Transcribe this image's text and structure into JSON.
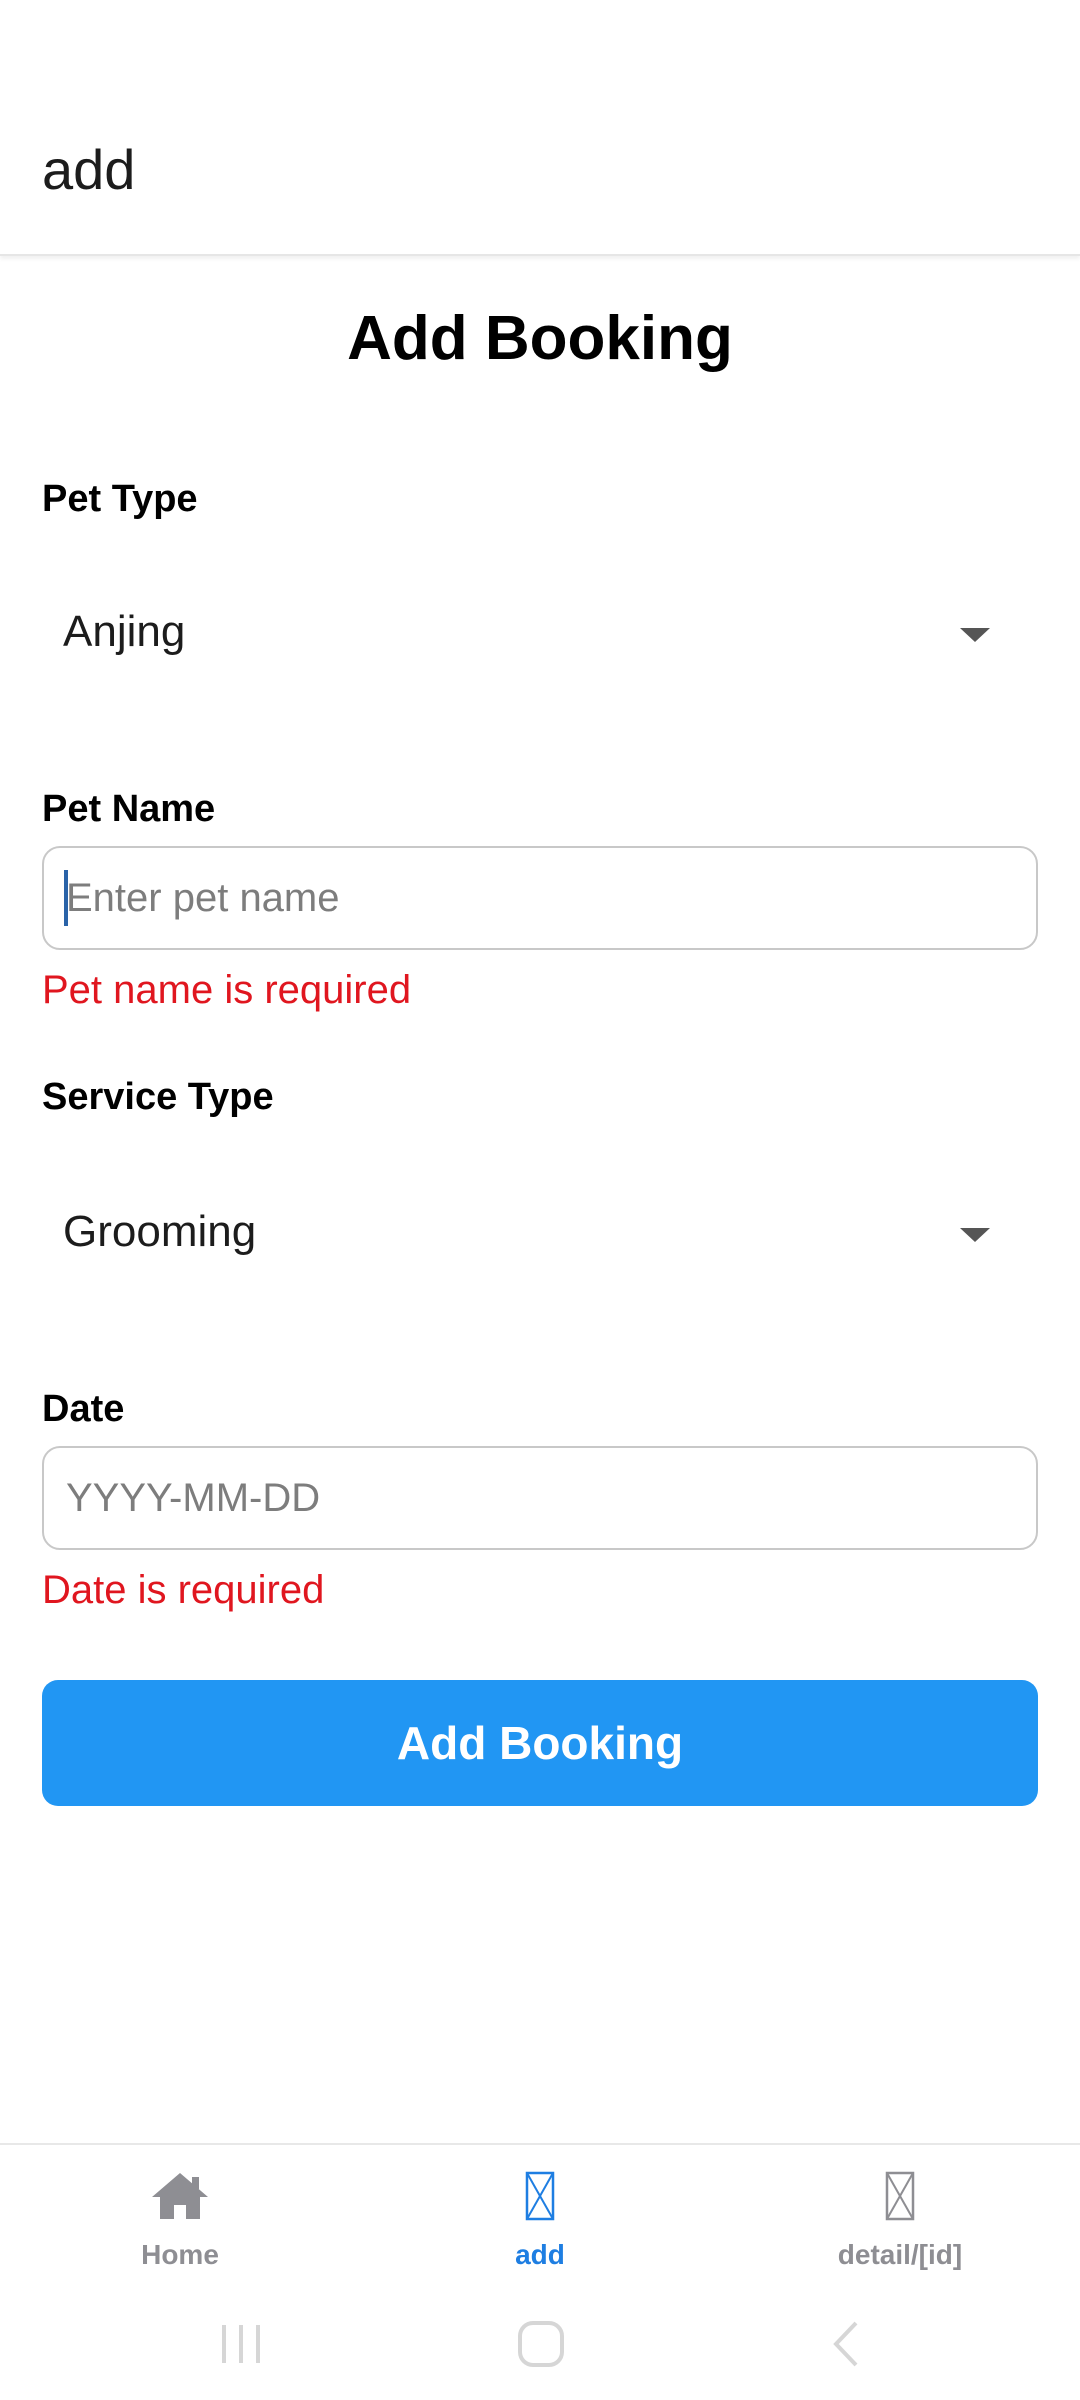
{
  "header": {
    "title": "add"
  },
  "form": {
    "title": "Add Booking",
    "pet_type": {
      "label": "Pet Type",
      "value": "Anjing"
    },
    "pet_name": {
      "label": "Pet Name",
      "placeholder": "Enter pet name",
      "value": "",
      "error": "Pet name is required"
    },
    "service_type": {
      "label": "Service Type",
      "value": "Grooming"
    },
    "date": {
      "label": "Date",
      "placeholder": "YYYY-MM-DD",
      "value": "",
      "error": "Date is required"
    },
    "submit_label": "Add Booking"
  },
  "tabs": [
    {
      "label": "Home",
      "icon": "home-icon",
      "active": false
    },
    {
      "label": "add",
      "icon": "placeholder-icon",
      "active": true
    },
    {
      "label": "detail/[id]",
      "icon": "placeholder-icon",
      "active": false
    }
  ],
  "colors": {
    "accent": "#2196f3",
    "active_tab": "#1e7ee2",
    "inactive_tab": "#8e8e93",
    "error": "#e0161f"
  }
}
